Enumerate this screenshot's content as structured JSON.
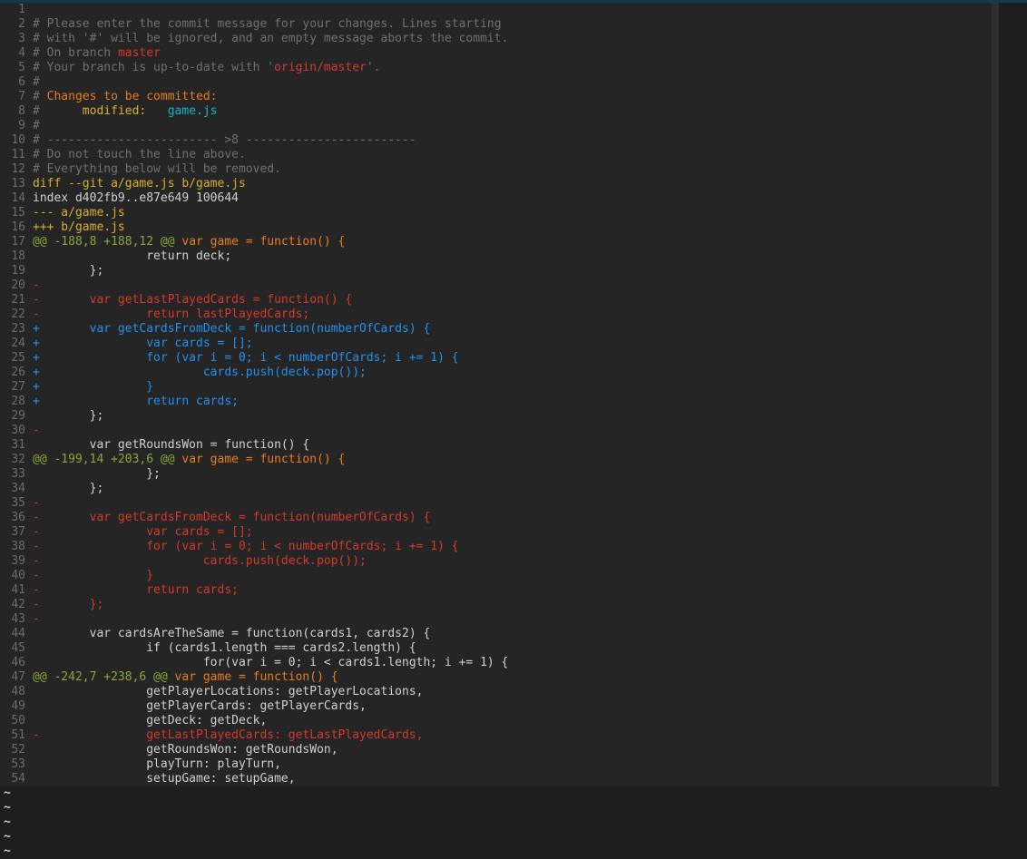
{
  "editor": {
    "lines": [
      {
        "n": "1",
        "segments": []
      },
      {
        "n": "2",
        "segments": [
          {
            "t": "# ",
            "c": "c-hash"
          },
          {
            "t": "Please enter the commit message for your changes. Lines starting",
            "c": "c-comment"
          }
        ]
      },
      {
        "n": "3",
        "segments": [
          {
            "t": "# ",
            "c": "c-hash"
          },
          {
            "t": "with '#' will be ignored, and an empty message aborts the commit.",
            "c": "c-comment"
          }
        ]
      },
      {
        "n": "4",
        "segments": [
          {
            "t": "# ",
            "c": "c-hash"
          },
          {
            "t": "On branch ",
            "c": "c-comment"
          },
          {
            "t": "master",
            "c": "c-red"
          }
        ]
      },
      {
        "n": "5",
        "segments": [
          {
            "t": "# ",
            "c": "c-hash"
          },
          {
            "t": "Your branch is up-to-date with '",
            "c": "c-comment"
          },
          {
            "t": "origin/master",
            "c": "c-red"
          },
          {
            "t": "'.",
            "c": "c-comment"
          }
        ]
      },
      {
        "n": "6",
        "segments": [
          {
            "t": "#",
            "c": "c-hash"
          }
        ]
      },
      {
        "n": "7",
        "segments": [
          {
            "t": "# ",
            "c": "c-hash"
          },
          {
            "t": "Changes to be committed:",
            "c": "c-orange"
          }
        ]
      },
      {
        "n": "8",
        "segments": [
          {
            "t": "# ",
            "c": "c-hash"
          },
          {
            "t": "     modified:   ",
            "c": "c-yellow"
          },
          {
            "t": "game.js",
            "c": "c-cyan"
          }
        ]
      },
      {
        "n": "9",
        "segments": [
          {
            "t": "#",
            "c": "c-hash"
          }
        ]
      },
      {
        "n": "10",
        "segments": [
          {
            "t": "# ",
            "c": "c-hash"
          },
          {
            "t": "------------------------ >8 ------------------------",
            "c": "c-comment"
          }
        ]
      },
      {
        "n": "11",
        "segments": [
          {
            "t": "# ",
            "c": "c-hash"
          },
          {
            "t": "Do not touch the line above.",
            "c": "c-comment"
          }
        ]
      },
      {
        "n": "12",
        "segments": [
          {
            "t": "# ",
            "c": "c-hash"
          },
          {
            "t": "Everything below will be removed.",
            "c": "c-comment"
          }
        ]
      },
      {
        "n": "13",
        "segments": [
          {
            "t": "diff --git a/game.js b/game.js",
            "c": "c-yellow"
          }
        ]
      },
      {
        "n": "14",
        "segments": [
          {
            "t": "index d402fb9..e87e649 100644",
            "c": "c-plain"
          }
        ]
      },
      {
        "n": "15",
        "segments": [
          {
            "t": "--- a/game.js",
            "c": "c-yellow"
          }
        ]
      },
      {
        "n": "16",
        "segments": [
          {
            "t": "+++ b/game.js",
            "c": "c-yellow"
          }
        ]
      },
      {
        "n": "17",
        "segments": [
          {
            "t": "@@ -188,8 +188,12 @@ ",
            "c": "c-green"
          },
          {
            "t": "var game = function() {",
            "c": "c-hunkfn"
          }
        ]
      },
      {
        "n": "18",
        "segments": [
          {
            "t": "                return deck;",
            "c": "c-plain"
          }
        ]
      },
      {
        "n": "19",
        "segments": [
          {
            "t": "        };",
            "c": "c-plain"
          }
        ]
      },
      {
        "n": "20",
        "segments": [
          {
            "t": "-",
            "c": "c-red"
          }
        ]
      },
      {
        "n": "21",
        "segments": [
          {
            "t": "-       var getLastPlayedCards = function() {",
            "c": "c-red"
          }
        ]
      },
      {
        "n": "22",
        "segments": [
          {
            "t": "-               return lastPlayedCards;",
            "c": "c-red"
          }
        ]
      },
      {
        "n": "23",
        "segments": [
          {
            "t": "+       var getCardsFromDeck = function(numberOfCards) {",
            "c": "c-blue"
          }
        ]
      },
      {
        "n": "24",
        "segments": [
          {
            "t": "+               var cards = [];",
            "c": "c-blue"
          }
        ]
      },
      {
        "n": "25",
        "segments": [
          {
            "t": "+               for (var i = 0; i < numberOfCards; i += 1) {",
            "c": "c-blue"
          }
        ]
      },
      {
        "n": "26",
        "segments": [
          {
            "t": "+                       cards.push(deck.pop());",
            "c": "c-blue"
          }
        ]
      },
      {
        "n": "27",
        "segments": [
          {
            "t": "+               }",
            "c": "c-blue"
          }
        ]
      },
      {
        "n": "28",
        "segments": [
          {
            "t": "+               return cards;",
            "c": "c-blue"
          }
        ]
      },
      {
        "n": "29",
        "segments": [
          {
            "t": "        };",
            "c": "c-plain"
          }
        ]
      },
      {
        "n": "30",
        "segments": [
          {
            "t": "-",
            "c": "c-red"
          }
        ]
      },
      {
        "n": "31",
        "segments": [
          {
            "t": "        var getRoundsWon = function() {",
            "c": "c-plain"
          }
        ]
      },
      {
        "n": "32",
        "segments": [
          {
            "t": "@@ -199,14 +203,6 @@ ",
            "c": "c-green"
          },
          {
            "t": "var game = function() {",
            "c": "c-hunkfn"
          }
        ]
      },
      {
        "n": "33",
        "segments": [
          {
            "t": "                };",
            "c": "c-plain"
          }
        ]
      },
      {
        "n": "34",
        "segments": [
          {
            "t": "        };",
            "c": "c-plain"
          }
        ]
      },
      {
        "n": "35",
        "segments": [
          {
            "t": "-",
            "c": "c-red"
          }
        ]
      },
      {
        "n": "36",
        "segments": [
          {
            "t": "-       var getCardsFromDeck = function(numberOfCards) {",
            "c": "c-red"
          }
        ]
      },
      {
        "n": "37",
        "segments": [
          {
            "t": "-               var cards = [];",
            "c": "c-red"
          }
        ]
      },
      {
        "n": "38",
        "segments": [
          {
            "t": "-               for (var i = 0; i < numberOfCards; i += 1) {",
            "c": "c-red"
          }
        ]
      },
      {
        "n": "39",
        "segments": [
          {
            "t": "-                       cards.push(deck.pop());",
            "c": "c-red"
          }
        ]
      },
      {
        "n": "40",
        "segments": [
          {
            "t": "-               }",
            "c": "c-red"
          }
        ]
      },
      {
        "n": "41",
        "segments": [
          {
            "t": "-               return cards;",
            "c": "c-red"
          }
        ]
      },
      {
        "n": "42",
        "segments": [
          {
            "t": "-       };",
            "c": "c-red"
          }
        ]
      },
      {
        "n": "43",
        "segments": [
          {
            "t": "-",
            "c": "c-red"
          }
        ]
      },
      {
        "n": "44",
        "segments": [
          {
            "t": "        var cardsAreTheSame = function(cards1, cards2) {",
            "c": "c-plain"
          }
        ]
      },
      {
        "n": "45",
        "segments": [
          {
            "t": "                if (cards1.length === cards2.length) {",
            "c": "c-plain"
          }
        ]
      },
      {
        "n": "46",
        "segments": [
          {
            "t": "                        for(var i = 0; i < cards1.length; i += 1) {",
            "c": "c-plain"
          }
        ]
      },
      {
        "n": "47",
        "segments": [
          {
            "t": "@@ -242,7 +238,6 @@ ",
            "c": "c-green"
          },
          {
            "t": "var game = function() {",
            "c": "c-hunkfn"
          }
        ]
      },
      {
        "n": "48",
        "segments": [
          {
            "t": "                getPlayerLocations: getPlayerLocations,",
            "c": "c-plain"
          }
        ]
      },
      {
        "n": "49",
        "segments": [
          {
            "t": "                getPlayerCards: getPlayerCards,",
            "c": "c-plain"
          }
        ]
      },
      {
        "n": "50",
        "segments": [
          {
            "t": "                getDeck: getDeck,",
            "c": "c-plain"
          }
        ]
      },
      {
        "n": "51",
        "segments": [
          {
            "t": "-               getLastPlayedCards: getLastPlayedCards,",
            "c": "c-red"
          }
        ]
      },
      {
        "n": "52",
        "segments": [
          {
            "t": "                getRoundsWon: getRoundsWon,",
            "c": "c-plain"
          }
        ]
      },
      {
        "n": "53",
        "segments": [
          {
            "t": "                playTurn: playTurn,",
            "c": "c-plain"
          }
        ]
      },
      {
        "n": "54",
        "segments": [
          {
            "t": "                setupGame: setupGame,",
            "c": "c-plain"
          }
        ]
      }
    ],
    "empty_line_markers": [
      "~",
      "~",
      "~",
      "~",
      "~"
    ]
  }
}
